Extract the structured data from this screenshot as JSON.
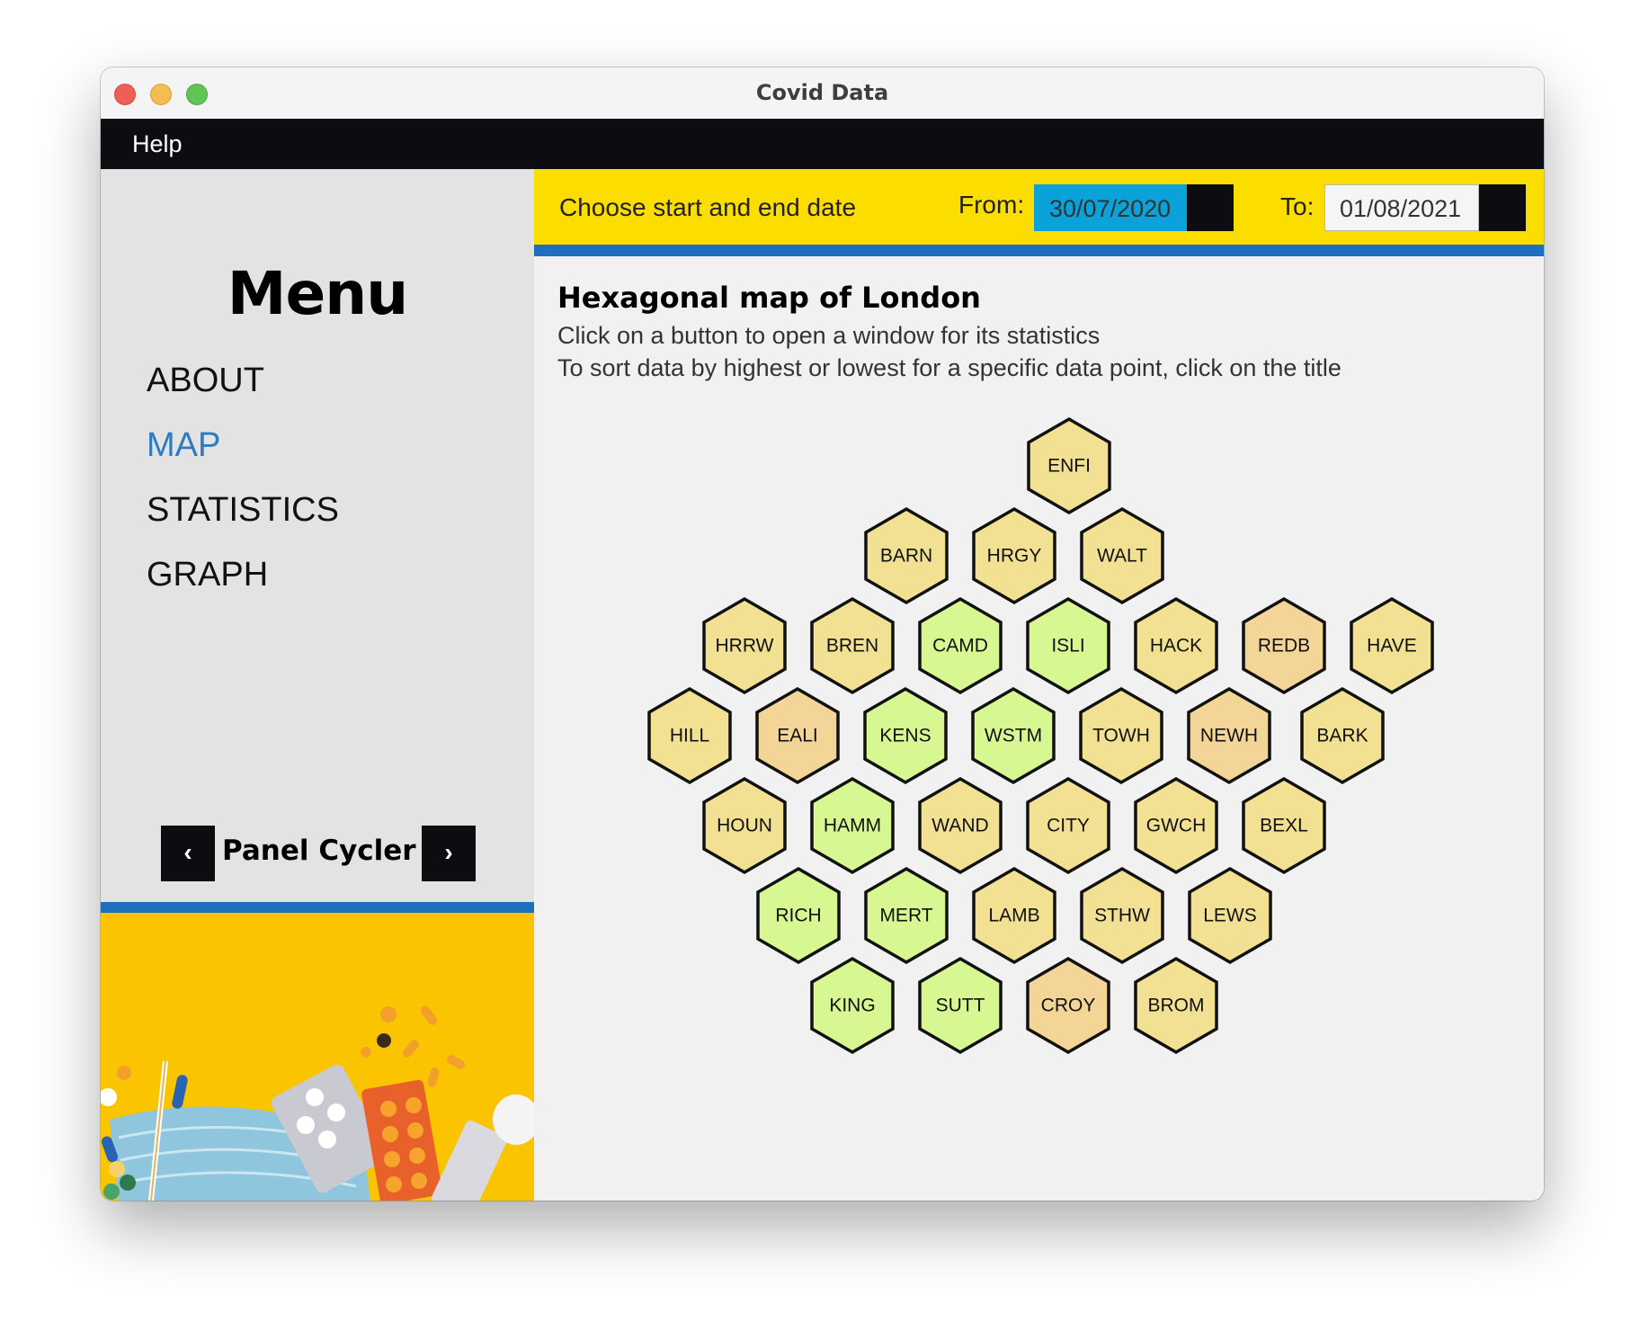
{
  "window": {
    "title": "Covid Data"
  },
  "menubar": {
    "help": "Help"
  },
  "sidebar": {
    "heading": "Menu",
    "items": [
      {
        "label": "ABOUT",
        "active": false
      },
      {
        "label": "MAP",
        "active": true
      },
      {
        "label": "STATISTICS",
        "active": false
      },
      {
        "label": "GRAPH",
        "active": false
      }
    ],
    "cycler": {
      "label": "Panel Cycler",
      "prev": "‹",
      "next": "›"
    }
  },
  "datebar": {
    "prompt": "Choose start and end date",
    "from_label": "From:",
    "from_value": "30/07/2020",
    "to_label": "To:",
    "to_value": "01/08/2021"
  },
  "map": {
    "title": "Hexagonal map of London",
    "line1": "Click on a button to open a window for its statistics",
    "line2": "To sort data by highest or lowest for a specific data point, click on the title",
    "colors": {
      "yellow": "#f3e193",
      "green": "#d6f792",
      "orange": "#f3d597"
    },
    "rows": [
      [
        {
          "code": "ENFI",
          "c": "yellow"
        }
      ],
      [
        {
          "code": "BARN",
          "c": "yellow"
        },
        {
          "code": "HRGY",
          "c": "yellow"
        },
        {
          "code": "WALT",
          "c": "yellow"
        }
      ],
      [
        {
          "code": "HRRW",
          "c": "yellow"
        },
        {
          "code": "BREN",
          "c": "yellow"
        },
        {
          "code": "CAMD",
          "c": "green"
        },
        {
          "code": "ISLI",
          "c": "green"
        },
        {
          "code": "HACK",
          "c": "yellow"
        },
        {
          "code": "REDB",
          "c": "orange"
        },
        {
          "code": "HAVE",
          "c": "yellow"
        }
      ],
      [
        {
          "code": "HILL",
          "c": "yellow"
        },
        {
          "code": "EALI",
          "c": "orange"
        },
        {
          "code": "KENS",
          "c": "green"
        },
        {
          "code": "WSTM",
          "c": "green"
        },
        {
          "code": "TOWH",
          "c": "yellow"
        },
        {
          "code": "NEWH",
          "c": "orange"
        },
        {
          "code": "BARK",
          "c": "yellow"
        }
      ],
      [
        {
          "code": "HOUN",
          "c": "yellow"
        },
        {
          "code": "HAMM",
          "c": "green"
        },
        {
          "code": "WAND",
          "c": "yellow"
        },
        {
          "code": "CITY",
          "c": "yellow"
        },
        {
          "code": "GWCH",
          "c": "yellow"
        },
        {
          "code": "BEXL",
          "c": "yellow"
        }
      ],
      [
        {
          "code": "RICH",
          "c": "green"
        },
        {
          "code": "MERT",
          "c": "green"
        },
        {
          "code": "LAMB",
          "c": "yellow"
        },
        {
          "code": "STHW",
          "c": "yellow"
        },
        {
          "code": "LEWS",
          "c": "yellow"
        }
      ],
      [
        {
          "code": "KING",
          "c": "green"
        },
        {
          "code": "SUTT",
          "c": "green"
        },
        {
          "code": "CROY",
          "c": "orange"
        },
        {
          "code": "BROM",
          "c": "yellow"
        }
      ]
    ]
  }
}
